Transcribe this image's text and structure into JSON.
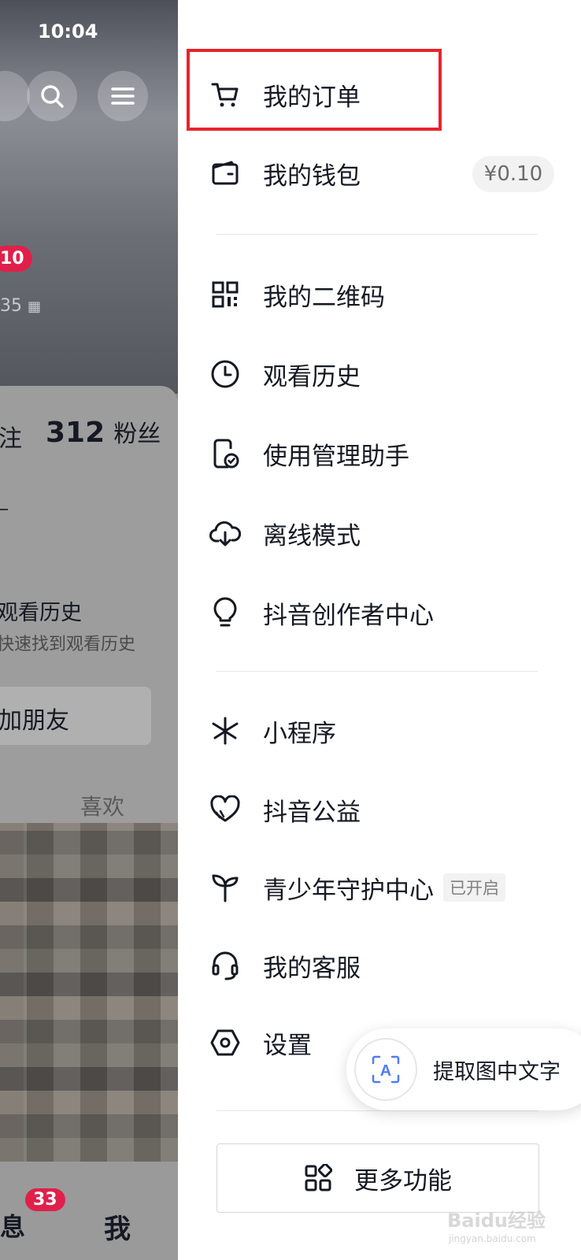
{
  "status": {
    "time": "10:04"
  },
  "left_page": {
    "badge_count": "10",
    "id_fragment": "35",
    "follow_fragment": "注",
    "fans_count": "312",
    "fans_label": "粉丝",
    "history_title": "观看历史",
    "history_sub": "快速找到观看历史",
    "add_friend": "加朋友",
    "like_tab": "喜欢",
    "msg_fragment": "息",
    "msg_badge": "33",
    "me_tab": "我"
  },
  "menu": {
    "groups": [
      [
        {
          "label": "我的订单",
          "icon": "cart-icon"
        },
        {
          "label": "我的钱包",
          "icon": "wallet-icon",
          "badge": "¥0.10"
        }
      ],
      [
        {
          "label": "我的二维码",
          "icon": "qrcode-icon"
        },
        {
          "label": "观看历史",
          "icon": "clock-icon"
        },
        {
          "label": "使用管理助手",
          "icon": "phone-check-icon"
        },
        {
          "label": "离线模式",
          "icon": "cloud-download-icon"
        },
        {
          "label": "抖音创作者中心",
          "icon": "lightbulb-icon"
        }
      ],
      [
        {
          "label": "小程序",
          "icon": "miniprogram-icon"
        },
        {
          "label": "抖音公益",
          "icon": "heart-icon"
        },
        {
          "label": "青少年守护中心",
          "icon": "sprout-icon",
          "tag": "已开启"
        },
        {
          "label": "我的客服",
          "icon": "headset-icon"
        },
        {
          "label": "设置",
          "icon": "hexagon-gear-icon"
        }
      ]
    ],
    "more_button": "更多功能"
  },
  "extract_text": {
    "label": "提取图中文字",
    "icon_letter": "A"
  },
  "watermark": {
    "main": "Baidu经验",
    "sub": "jingyan.baidu.com"
  },
  "colors": {
    "highlight": "#e8232c",
    "badge_red": "#e0204a"
  }
}
